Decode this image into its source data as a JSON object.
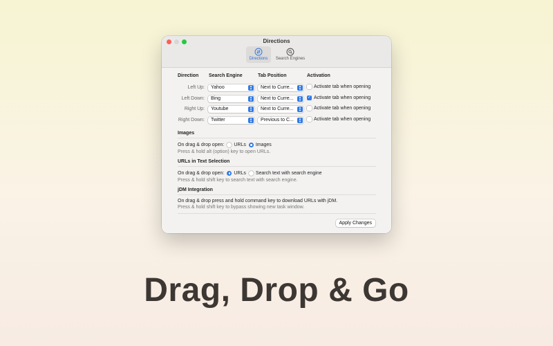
{
  "window": {
    "title": "Directions",
    "tabs": [
      {
        "label": "Directions",
        "icon": "arrows-circle-icon",
        "active": true
      },
      {
        "label": "Search Engines",
        "icon": "magnifier-icon",
        "active": false
      }
    ]
  },
  "directions": {
    "headers": {
      "direction": "Direction",
      "engine": "Search Engine",
      "tab": "Tab Position",
      "activation": "Activation"
    },
    "rows": [
      {
        "label": "Left Up:",
        "engine": "Yahoo",
        "tab": "Next to Curre...",
        "activation": "Activate tab when opening",
        "checked": false
      },
      {
        "label": "Left Down:",
        "engine": "Bing",
        "tab": "Next to Curre...",
        "activation": "Activate tab when opening",
        "checked": true
      },
      {
        "label": "Right Up:",
        "engine": "Youtube",
        "tab": "Next to Curre...",
        "activation": "Activate tab when opening",
        "checked": false
      },
      {
        "label": "Right Down:",
        "engine": "Twitter",
        "tab": "Previous to C...",
        "activation": "Activate tab when opening",
        "checked": false
      }
    ]
  },
  "images": {
    "title": "Images",
    "prompt": "On drag & drop open:",
    "options": [
      "URLs",
      "Images"
    ],
    "selected": "Images",
    "hint": "Press & hold alt (option) key to open URLs."
  },
  "text_selection": {
    "title": "URLs in Text Selection",
    "prompt": "On drag & drop open:",
    "options": [
      "URLs",
      "Search text with search engine"
    ],
    "selected": "URLs",
    "hint": "Press & hold shift key to search text with search engine."
  },
  "jdm": {
    "title": "jDM Integration",
    "line": "On drag & drop press and hold command key to download URLs with jDM.",
    "hint": "Press & hold shift key to bypass showing new task window."
  },
  "apply_label": "Apply Changes",
  "tagline": "Drag, Drop & Go",
  "colors": {
    "accent": "#2f7ae5",
    "close": "#fe5f57",
    "zoom": "#28c840",
    "tagline": "#3d3734"
  }
}
